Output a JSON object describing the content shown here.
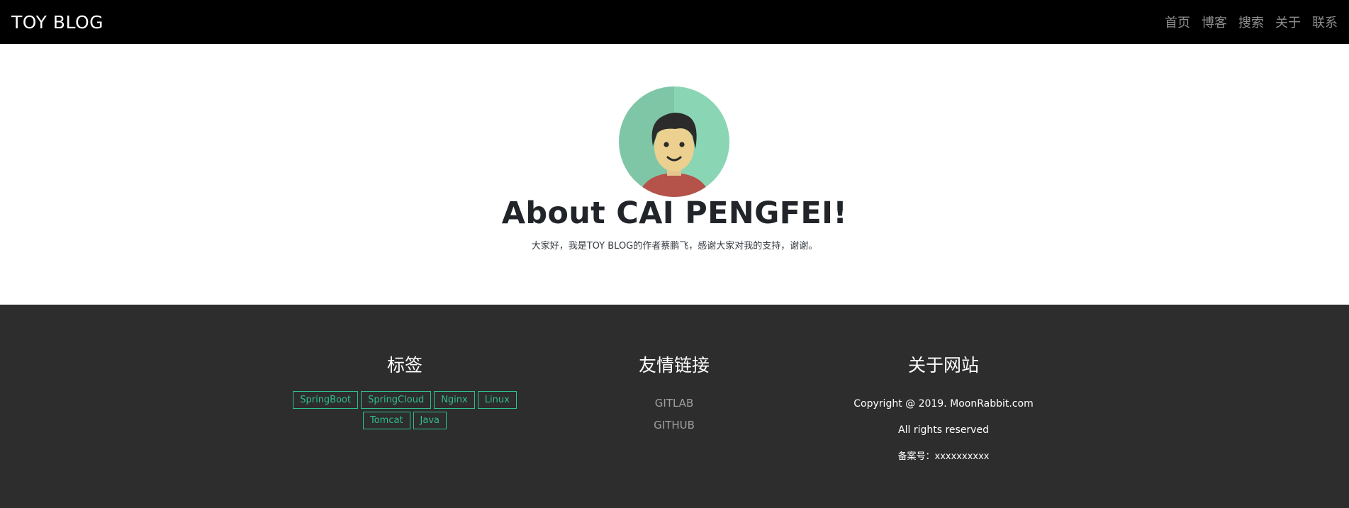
{
  "navbar": {
    "brand": "TOY BLOG",
    "links": [
      "首页",
      "博客",
      "搜索",
      "关于",
      "联系"
    ]
  },
  "hero": {
    "avatar_icon": "avatar-illustration",
    "title": "About CAI PENGFEI!",
    "subtitle": "大家好，我是TOY BLOG的作者蔡鹏飞，感谢大家对我的支持，谢谢。"
  },
  "footer": {
    "tags": {
      "heading": "标签",
      "items": [
        "SpringBoot",
        "SpringCloud",
        "Nginx",
        "Linux",
        "Tomcat",
        "Java"
      ]
    },
    "links": {
      "heading": "友情链接",
      "items": [
        "GITLAB",
        "GITHUB"
      ]
    },
    "about": {
      "heading": "关于网站",
      "copyright": "Copyright @ 2019. MoonRabbit.com",
      "rights": "All rights reserved",
      "record": "备案号：xxxxxxxxxx"
    }
  },
  "colors": {
    "navbar_bg": "#000000",
    "footer_bg": "#2d2d2d",
    "tag_accent": "#2fbf8f",
    "avatar_bg": "#8ad6b4"
  }
}
